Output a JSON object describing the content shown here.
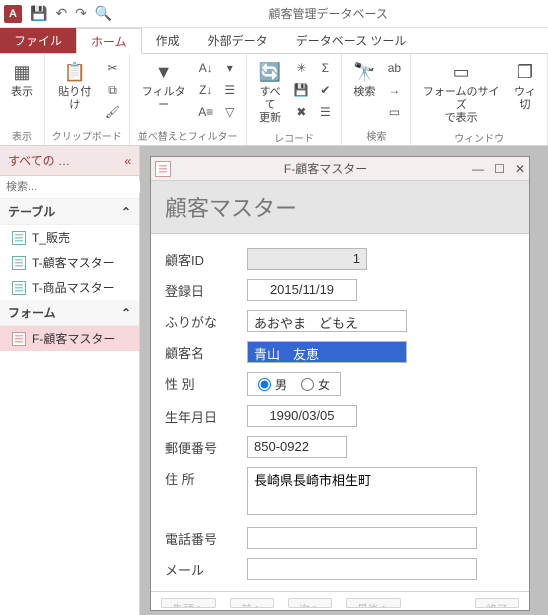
{
  "app": {
    "title": "顧客管理データベース",
    "icon_letter": "A"
  },
  "qat": {
    "save": "💾",
    "undo": "↶",
    "redo": "↷",
    "print": "🔍"
  },
  "tabs": {
    "file": "ファイル",
    "home": "ホーム",
    "create": "作成",
    "external": "外部データ",
    "dbtools": "データベース ツール"
  },
  "ribbon": {
    "view": {
      "label": "表示",
      "group": "表示"
    },
    "clipboard": {
      "paste": "貼り付け",
      "group": "クリップボード"
    },
    "sort": {
      "filter": "フィルター",
      "group": "並べ替えとフィルター"
    },
    "records": {
      "refresh": "すべて\n更新",
      "group": "レコード"
    },
    "find": {
      "label": "検索",
      "group": "検索"
    },
    "window": {
      "formsize": "フォームのサイズ\nで表示",
      "switch": "ウィ\n切",
      "group": "ウィンドウ"
    }
  },
  "nav": {
    "header": "すべての  …",
    "search_placeholder": "検索...",
    "sections": {
      "tables": "テーブル",
      "forms": "フォーム"
    },
    "tables": [
      {
        "label": "T_販売"
      },
      {
        "label": "T-顧客マスター"
      },
      {
        "label": "T-商品マスター"
      }
    ],
    "forms": [
      {
        "label": "F-顧客マスター",
        "selected": true
      }
    ]
  },
  "formwin": {
    "title": "F-顧客マスター",
    "header": "顧客マスター",
    "fields": {
      "id_label": "顧客ID",
      "id_value": "1",
      "regdate_label": "登録日",
      "regdate_value": "2015/11/19",
      "furigana_label": "ふりがな",
      "furigana_value": "あおやま　どもえ",
      "name_label": "顧客名",
      "name_value": "青山　友恵",
      "gender_label": "性 別",
      "gender_m": "男",
      "gender_f": "女",
      "birth_label": "生年月日",
      "birth_value": "1990/03/05",
      "zip_label": "郵便番号",
      "zip_value": "850-0922",
      "addr_label": "住 所",
      "addr_value": "長崎県長崎市相生町",
      "tel_label": "電話番号",
      "tel_value": "",
      "mail_label": "メール",
      "mail_value": ""
    },
    "buttons": {
      "b1": "先頭へ",
      "b2": "前へ",
      "b3": "次へ",
      "b4": "最後へ",
      "b5": "終了"
    }
  }
}
